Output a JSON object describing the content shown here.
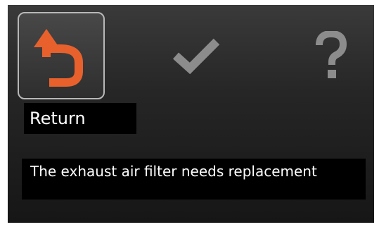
{
  "icons": {
    "return": "return-arrow-icon",
    "confirm": "checkmark-icon",
    "help": "question-mark-icon"
  },
  "colors": {
    "accent": "#e8612c",
    "inactive_icon": "#8c8c8c",
    "selection_border": "#b8b8b8",
    "text": "#ffffff"
  },
  "selected_item": {
    "label": "Return"
  },
  "message": {
    "text": "The exhaust air filter needs replacement"
  }
}
